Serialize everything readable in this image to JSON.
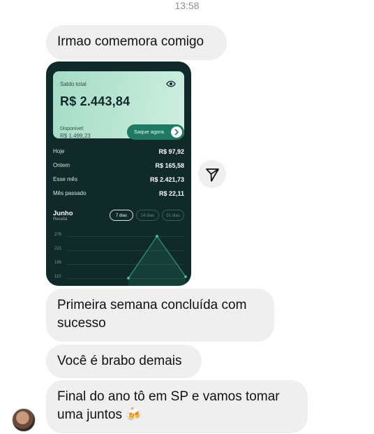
{
  "status": {
    "time": "13:58"
  },
  "messages": [
    {
      "text": "Irmao comemora comigo"
    },
    {
      "text": "Primeira semana concluída com sucesso"
    },
    {
      "text": "Você é brabo demais"
    },
    {
      "text": "Final do ano tô em SP e vamos tomar uma juntos 🍻"
    }
  ],
  "card": {
    "balance_label": "Saldo total",
    "balance_value": "R$ 2.443,84",
    "available_label": "Disponível:",
    "available_value": "R$ 1.499,23",
    "withdraw_button": "Saque agora",
    "stats": [
      {
        "label": "Hoje",
        "value": "R$ 97,92"
      },
      {
        "label": "Ontem",
        "value": "R$ 165,58"
      },
      {
        "label": "Esse mês",
        "value": "R$ 2.421,73"
      },
      {
        "label": "Mês passado",
        "value": "R$ 22,11"
      }
    ],
    "chart": {
      "month": "Junho",
      "subtitle": "Receita",
      "ranges": [
        "7 dias",
        "14 dias",
        "31 dias"
      ],
      "selected_range": "7 dias",
      "accent_color": "#2f9a78"
    }
  },
  "chart_data": {
    "type": "area",
    "title": "Junho",
    "subtitle": "Receita",
    "yticks": [
      276,
      221,
      166,
      110
    ],
    "ylim": [
      110,
      276
    ],
    "x": [
      1,
      2,
      3
    ],
    "values": [
      110,
      276,
      116
    ],
    "grid": true
  },
  "icons": {
    "eye": "eye-icon",
    "arrow": "chevron-right-icon",
    "send": "send-icon"
  }
}
